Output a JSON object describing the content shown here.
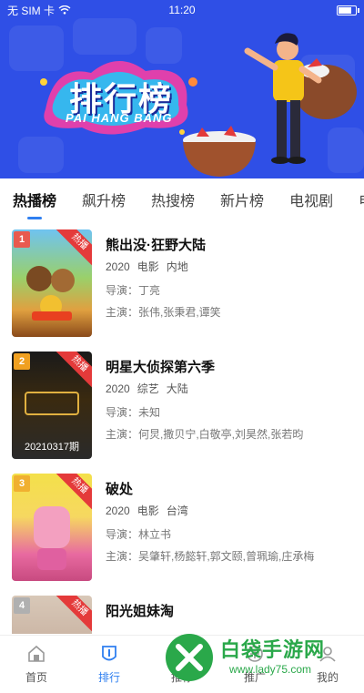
{
  "status_bar": {
    "carrier": "无 SIM 卡",
    "time": "11:20",
    "battery_level": 0.85
  },
  "banner": {
    "title": "排行榜",
    "subtitle": "PAI HANG BANG"
  },
  "tabs": [
    {
      "label": "热播榜",
      "active": true
    },
    {
      "label": "飙升榜",
      "active": false
    },
    {
      "label": "热搜榜",
      "active": false
    },
    {
      "label": "新片榜",
      "active": false
    },
    {
      "label": "电视剧",
      "active": false
    },
    {
      "label": "电影",
      "active": false
    }
  ],
  "list": [
    {
      "rank": "1",
      "badge": "热播",
      "title": "熊出没·狂野大陆",
      "year": "2020",
      "category": "电影",
      "region": "内地",
      "director_label": "导演：",
      "director": "丁亮",
      "cast_label": "主演：",
      "cast": "张伟,张秉君,谭笑",
      "poster_caption": "",
      "rank_color": "#e85a4f"
    },
    {
      "rank": "2",
      "badge": "热播",
      "title": "明星大侦探第六季",
      "year": "2020",
      "category": "综艺",
      "region": "大陆",
      "director_label": "导演：",
      "director": "未知",
      "cast_label": "主演：",
      "cast": "何炅,撒贝宁,白敬亭,刘昊然,张若昀",
      "poster_caption": "20210317期",
      "rank_color": "#f0a020"
    },
    {
      "rank": "3",
      "badge": "热播",
      "title": "破处",
      "year": "2020",
      "category": "电影",
      "region": "台湾",
      "director_label": "导演：",
      "director": "林立书",
      "cast_label": "主演：",
      "cast": "吴肇轩,杨懿轩,郭文颐,曾珮瑜,庄承梅",
      "poster_caption": "",
      "rank_color": "#f0b030"
    },
    {
      "rank": "4",
      "badge": "热播",
      "title": "阳光姐妹淘",
      "year": "",
      "category": "",
      "region": "",
      "director_label": "",
      "director": "",
      "cast_label": "",
      "cast": "",
      "poster_caption": "",
      "rank_color": "#b0b0b0"
    }
  ],
  "bottom_nav": [
    {
      "label": "首页",
      "icon": "home-icon",
      "active": false
    },
    {
      "label": "排行",
      "icon": "ranking-icon",
      "active": true
    },
    {
      "label": "推荐",
      "icon": "recommend-icon",
      "active": false
    },
    {
      "label": "推广",
      "icon": "promote-icon",
      "active": false
    },
    {
      "label": "我的",
      "icon": "profile-icon",
      "active": false
    }
  ],
  "watermark": {
    "name": "白袋手游网",
    "url": "www.lady75.com"
  },
  "colors": {
    "banner_bg": "#2f4fe6",
    "accent": "#2f7ff0",
    "hot_ribbon": "#e43a3a",
    "watermark_green": "#2aa84a"
  }
}
